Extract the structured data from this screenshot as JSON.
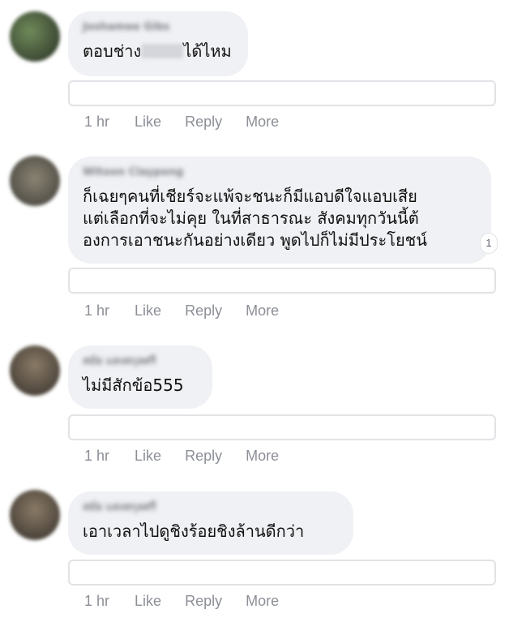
{
  "comments": [
    {
      "author": "Joshamee Gibs",
      "text_before": "ตอบช่าง",
      "text_after": "ได้ไหม",
      "time": "1 hr",
      "like": "Like",
      "reply": "Reply",
      "more": "More"
    },
    {
      "author": "Witoon Claypong",
      "line1": "ก็เฉยๆคนที่เชียร์จะแพ้จะชนะก็มีแอบดีใจแอบเสีย",
      "line2": "แต่เลือกที่จะไม่คุย ในที่สาธารณะ สังคมทุกวันนี้ต้",
      "line3": "องการเอาชนะกันอย่างเดียว พูดไปก็ไม่มีประโยชน์",
      "reaction_count": "1",
      "time": "1 hr",
      "like": "Like",
      "reply": "Reply",
      "more": "More"
    },
    {
      "author": "สมัย แสงสกุลศรี",
      "text": "ไม่มีสักข้อ555",
      "time": "1 hr",
      "like": "Like",
      "reply": "Reply",
      "more": "More"
    },
    {
      "author": "สมัย แสงสกุลศรี",
      "text": "เอาเวลาไปดูชิงร้อยชิงล้านดีกว่า",
      "time": "1 hr",
      "like": "Like",
      "reply": "Reply",
      "more": "More"
    }
  ],
  "colors": {
    "bubble": "#f0f1f4",
    "action_text": "#8c8f96",
    "border": "#e2e3e6"
  }
}
